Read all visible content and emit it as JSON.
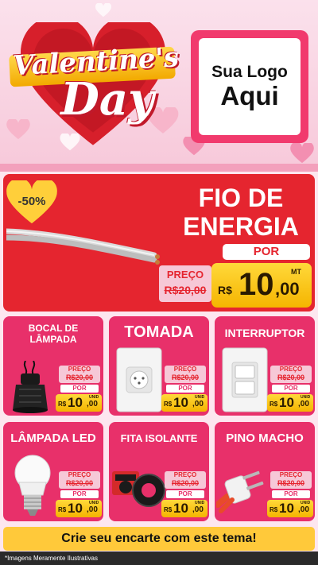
{
  "header": {
    "title_line1": "Valentine's",
    "title_line2": "Day",
    "logo_line1": "Sua Logo",
    "logo_line2": "Aqui"
  },
  "main_offer": {
    "discount": "-50%",
    "title_line1": "FIO DE",
    "title_line2": "ENERGIA",
    "por_label": "POR",
    "preco_label": "PREÇO",
    "old_price": "R$20,00",
    "currency": "R$",
    "price_int": "10",
    "price_cents": ",00",
    "unit": "MT"
  },
  "cards": [
    {
      "title_line1": "BOCAL DE",
      "title_line2": "LÂMPADA",
      "preco_label": "PREÇO",
      "old_price": "R$20,00",
      "por_label": "POR",
      "currency": "R$",
      "price_int": "10",
      "price_cents": ",00",
      "unit": "UNID"
    },
    {
      "title_line1": "TOMADA",
      "preco_label": "PREÇO",
      "old_price": "R$20,00",
      "por_label": "POR",
      "currency": "R$",
      "price_int": "10",
      "price_cents": ",00",
      "unit": "UNID"
    },
    {
      "title_line1": "INTERRUPTOR",
      "preco_label": "PREÇO",
      "old_price": "R$20,00",
      "por_label": "POR",
      "currency": "R$",
      "price_int": "10",
      "price_cents": ",00",
      "unit": "UNID"
    },
    {
      "title_line1": "LÂMPADA LED",
      "preco_label": "PREÇO",
      "old_price": "R$20,00",
      "por_label": "POR",
      "currency": "R$",
      "price_int": "10",
      "price_cents": ",00",
      "unit": "UNID"
    },
    {
      "title_line1": "FITA ISOLANTE",
      "preco_label": "PREÇO",
      "old_price": "R$20,00",
      "por_label": "POR",
      "currency": "R$",
      "price_int": "10",
      "price_cents": ",00",
      "unit": "UNID"
    },
    {
      "title_line1": "PINO MACHO",
      "preco_label": "PREÇO",
      "old_price": "R$20,00",
      "por_label": "POR",
      "currency": "R$",
      "price_int": "10",
      "price_cents": ",00",
      "unit": "UNID"
    }
  ],
  "cta": "Crie seu encarte com este tema!",
  "footer": "*Imagens Meramente Ilustrativas",
  "colors": {
    "accent_red": "#e5252f",
    "card_pink": "#e8306a",
    "price_yellow": "#ffc93a"
  }
}
